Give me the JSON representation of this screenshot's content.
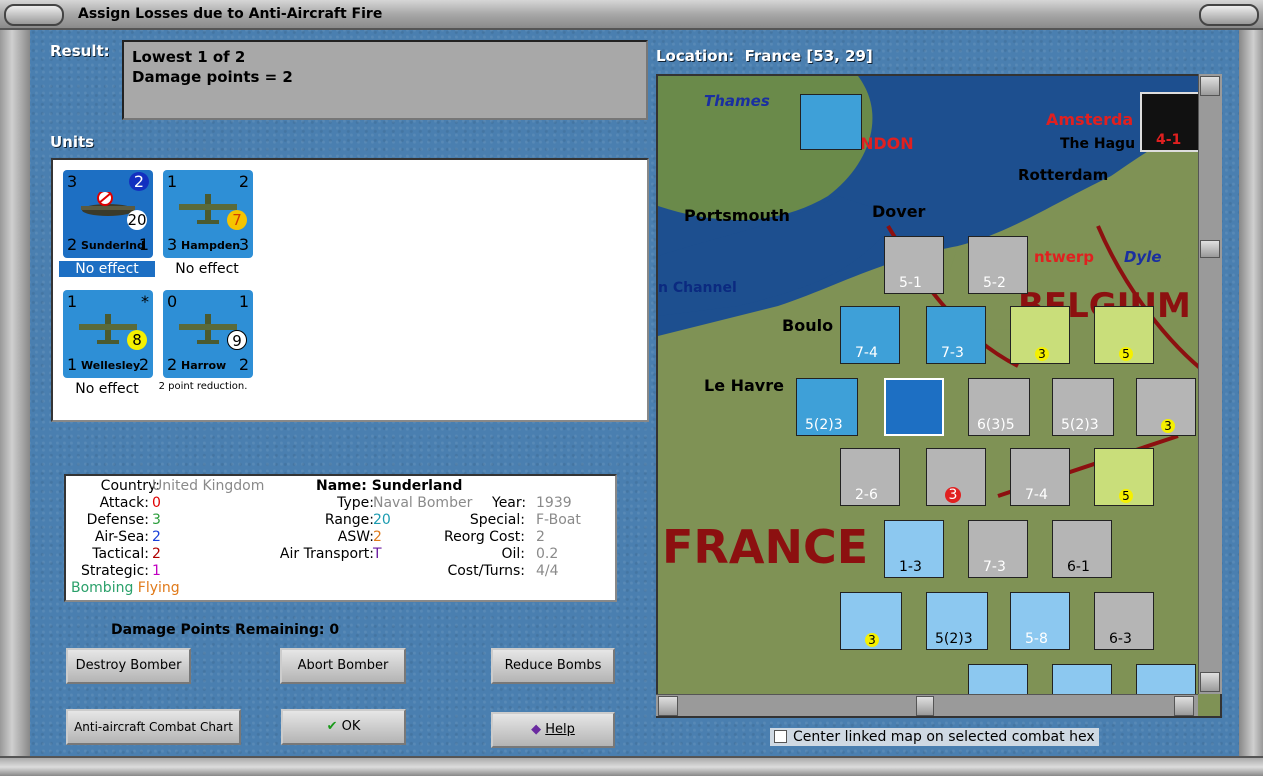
{
  "window": {
    "title": "Assign Losses due to Anti-Aircraft Fire"
  },
  "result": {
    "label": "Result:",
    "line1": "Lowest 1 of 2",
    "line2": "Damage points = 2"
  },
  "units": {
    "label": "Units",
    "cards": [
      {
        "name": "Sunderlnd",
        "tl": "3",
        "tr": "2",
        "bl": "2",
        "br": "1",
        "badge": "20",
        "status": "No effect",
        "selected": true
      },
      {
        "name": "Hampden",
        "tl": "1",
        "tr": "2",
        "bl": "3",
        "br": "3",
        "badge": "7",
        "status": "No effect"
      },
      {
        "name": "Wellesley",
        "tl": "1",
        "tr": "*",
        "bl": "1",
        "br": "2",
        "badge": "8",
        "status": "No effect"
      },
      {
        "name": "Harrow",
        "tl": "0",
        "tr": "1",
        "bl": "2",
        "br": "2",
        "badge": "9",
        "status": "2 point reduction."
      }
    ]
  },
  "info": {
    "country_k": "Country:",
    "country_v": "United Kingdom",
    "attack_k": "Attack:",
    "attack_v": "0",
    "defense_k": "Defense:",
    "defense_v": "3",
    "airsea_k": "Air-Sea:",
    "airsea_v": "2",
    "tactical_k": "Tactical:",
    "tactical_v": "2",
    "strategic_k": "Strategic:",
    "strategic_v": "1",
    "bombing": "Bombing",
    "flying": "Flying",
    "name_k": "Name:",
    "name_v": "Sunderland",
    "type_k": "Type:",
    "type_v": "Naval Bomber",
    "year_k": "Year:",
    "year_v": "1939",
    "range_k": "Range:",
    "range_v": "20",
    "special_k": "Special:",
    "special_v": "F-Boat",
    "asw_k": "ASW:",
    "asw_v": "2",
    "reorg_k": "Reorg Cost:",
    "reorg_v": "2",
    "airtrans_k": "Air Transport:",
    "airtrans_v": "T",
    "oil_k": "Oil:",
    "oil_v": "0.2",
    "cost_k": "Cost/Turns:",
    "cost_v": "4/4"
  },
  "damage": {
    "label": "Damage Points Remaining:",
    "value": "0"
  },
  "buttons": {
    "destroy": "Destroy Bomber",
    "abort": "Abort Bomber",
    "reduce": "Reduce Bombs",
    "chart": "Anti-aircraft Combat Chart",
    "ok": "OK",
    "help": "Help"
  },
  "location": {
    "label": "Location:",
    "value": "France [53, 29]"
  },
  "map": {
    "places": [
      "Thames",
      "NDON",
      "Amsterda",
      "The Hagu",
      "Rotterdam",
      "Portsmouth",
      "Dover",
      "ntwerp",
      "Dyle",
      "n Channel",
      "Boulo",
      "Le Havre",
      "FRANCE",
      "BELGIUM"
    ],
    "counters": [
      "5-1",
      "5-2",
      "7-4",
      "7-3",
      "5(2)3",
      "6(3)5",
      "5(2)3",
      "2-6",
      "3",
      "7-4",
      "1-3",
      "7-3",
      "6-1",
      "5(2)3",
      "5-8",
      "6-3",
      "4-1",
      "3",
      "5",
      "3",
      "5",
      "3"
    ]
  },
  "checkbox": {
    "label": "Center linked map on selected combat hex"
  },
  "colors": {
    "accent": "#1d6fc3",
    "attack": "#e00000",
    "defense": "#2a9d3a",
    "airsea": "#1a3fd8",
    "tactical": "#b00000",
    "strategic": "#c000c0",
    "bombing": "#2aa06a",
    "flying": "#e07a1a",
    "gray_val": "#8a8a8a",
    "range": "#1a9bb0",
    "asw": "#e07a1a",
    "airtrans": "#6a1aa0"
  }
}
